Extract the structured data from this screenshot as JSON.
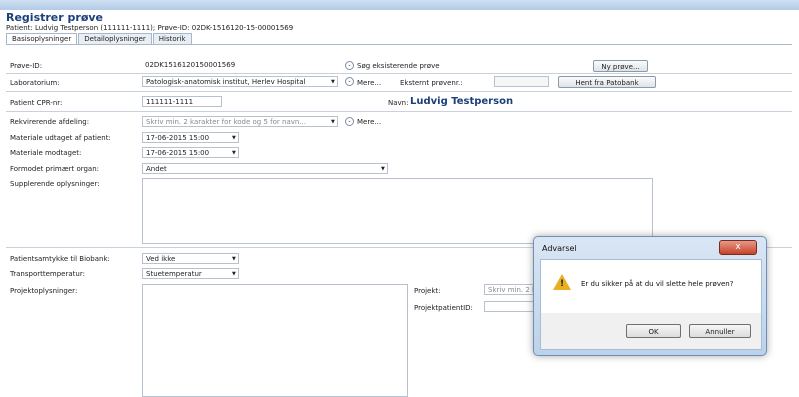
{
  "header": {
    "title": "Registrer prøve",
    "subtitle": "Patient: Ludvig Testperson (111111-1111); Prøve-ID: 02DK-1516120-15-00001569"
  },
  "tabs": [
    {
      "label": "Basisoplysninger"
    },
    {
      "label": "Detailoplysninger"
    },
    {
      "label": "Historik"
    }
  ],
  "form": {
    "prove_id_label": "Prøve-ID:",
    "prove_id_value": "02DK1516120150001569",
    "search_existing_label": "Søg eksisterende prøve",
    "new_sample_button": "Ny prøve...",
    "lab_label": "Laboratorium:",
    "lab_value": "Patologisk-anatomisk institut, Herlev Hospital",
    "more_label": "Mere...",
    "external_no_label": "Eksternt prøvenr.:",
    "external_no_value": "",
    "fetch_patobank_button": "Hent fra Patobank",
    "cpr_label": "Patient CPR-nr:",
    "cpr_value": "111111-1111",
    "name_label": "Navn:",
    "name_value": "Ludvig Testperson",
    "requesting_dept_label": "Rekvirerende afdeling:",
    "requesting_dept_placeholder": "Skriv min. 2 karakter for kode og 5 for navn...",
    "more2_label": "Mere...",
    "material_taken_label": "Materiale udtaget af patient:",
    "material_taken_value": "17-06-2015 15:00",
    "material_received_label": "Materiale modtaget:",
    "material_received_value": "17-06-2015 15:00",
    "organ_label": "Formodet primært organ:",
    "organ_value": "Andet",
    "supplementary_label": "Supplerende oplysninger:",
    "biobank_consent_label": "Patientsamtykke til Biobank:",
    "biobank_consent_value": "Ved ikke",
    "transport_temp_label": "Transporttemperatur:",
    "transport_temp_value": "Stuetemperatur",
    "project_info_label": "Projektoplysninger:",
    "project_label": "Projekt:",
    "project_placeholder": "Skriv min. 2 k",
    "project_patient_id_label": "ProjektpatientID:"
  },
  "dialog": {
    "title": "Advarsel",
    "close_glyph": "x",
    "icon": "warning-icon",
    "message": "Er du sikker på at du vil slette hele prøven?",
    "ok_label": "OK",
    "cancel_label": "Annuller"
  },
  "colors": {
    "title": "#1b3f7a",
    "accent": "#b3cbe6"
  }
}
